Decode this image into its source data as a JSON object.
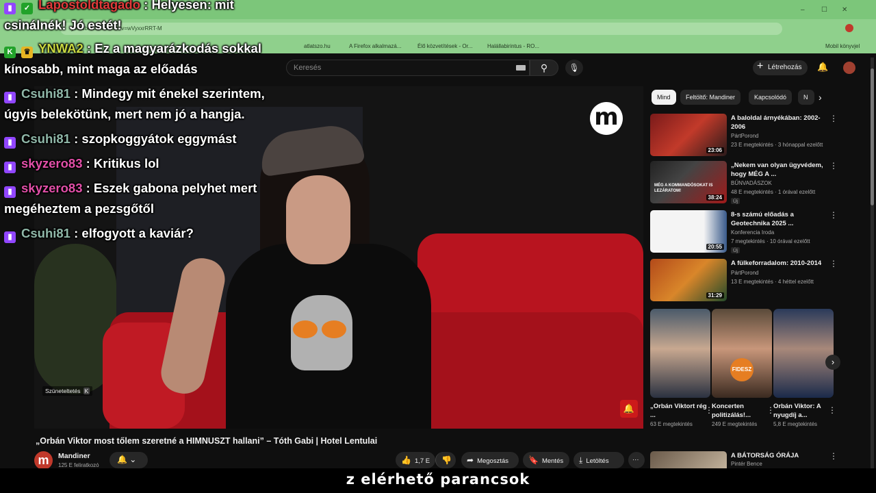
{
  "browser": {
    "url": "youtube.com/watch?v=wVyxxrRRT-M",
    "bookmarks": [
      "atlatszo.hu",
      "A Firefox alkalmazá...",
      "Élő közvetítések - Or...",
      "Halállabirintus - RO...",
      "Mobil könyvjel"
    ],
    "window_controls": [
      "–",
      "☐",
      "✕"
    ]
  },
  "youtube": {
    "search_placeholder": "Keresés",
    "create_label": "Létrehozás",
    "video": {
      "logo_letter": "m",
      "pause_tip": "Szüneteltetés",
      "pause_key": "K",
      "title": "„Orbán Viktor most tőlem szeretné a HIMNUSZT hallani” – Tóth Gabi | Hotel Lentulai",
      "channel": "Mandiner",
      "channel_letter": "m",
      "subscribers": "125 E feliratkozó",
      "like_count": "1,7 E",
      "share_label": "Megosztás",
      "save_label": "Mentés",
      "download_label": "Letöltés"
    },
    "chips": [
      "Mind",
      "Feltöltő: Mandiner",
      "Kapcsolódó",
      "N"
    ],
    "recommendations": [
      {
        "title": "A baloldal árnyékában: 2002-2006",
        "channel": "PártPorond",
        "meta": "23 E megtekintés · 3 hónappal ezelőtt",
        "duration": "23:06",
        "new": ""
      },
      {
        "title": "„Nekem van olyan ügyvédem, hogy MÉG A ...",
        "channel": "BŰNVADÁSZOK",
        "meta": "48 E megtekintés · 1 órával ezelőtt",
        "duration": "38:24",
        "new": "Új",
        "thumb_text": "MÉG A KOMMANDÓSOKAT IS LEZÁRATOM!"
      },
      {
        "title": "8-s számú előadás a Geotechnika 2025 ...",
        "channel": "Konferencia Iroda",
        "meta": "7 megtekintés · 10 órával ezelőtt",
        "duration": "20:55",
        "new": "Új"
      },
      {
        "title": "A fülkeforradalom: 2010-2014",
        "channel": "PártPorond",
        "meta": "13 E megtekintés · 4 héttel ezelőtt",
        "duration": "31:29",
        "new": ""
      }
    ],
    "shorts": [
      {
        "title": "„Orbán Viktort rég ...",
        "views": "63 E megtekintés"
      },
      {
        "title": "Koncerten politizálás!...",
        "views": "249 E megtekintés",
        "thumb_text": "FIDESZ"
      },
      {
        "title": "Orbán Viktor: A nyugdíj a...",
        "views": "5,8 E megtekintés"
      }
    ],
    "bottom_rec": {
      "title": "A BÁTORSÁG ÓRÁJA",
      "channel": "Pintér Bence"
    }
  },
  "chat": [
    {
      "badges": [
        "twitch",
        "green"
      ],
      "user": "Lapostoldtagado",
      "user_color": "#e03b3b",
      "message": " : Helyesen: mit",
      "cont": "csinálnék! Jó estét!"
    },
    {
      "badges": [
        "green",
        "crown"
      ],
      "user": "YNWA2",
      "user_color": "#c9d840",
      "message": " : Ez a magyarázkodás sokkal",
      "cont": "kínosabb, mint maga az előadás"
    },
    {
      "badges": [
        "twitch"
      ],
      "user": "Csuhi81",
      "user_color": "#8fb7a8",
      "message": " : Mindegy mit énekel szerintem,",
      "cont": "úgyis belekötünk, mert nem jó a hangja."
    },
    {
      "badges": [
        "twitch"
      ],
      "user": "Csuhi81",
      "user_color": "#8fb7a8",
      "message": " : szopkoggyátok eggymást",
      "cont": ""
    },
    {
      "badges": [
        "twitch"
      ],
      "user": "skyzero83",
      "user_color": "#e24fa8",
      "message": " : Kritikus lol",
      "cont": ""
    },
    {
      "badges": [
        "twitch"
      ],
      "user": "skyzero83",
      "user_color": "#e24fa8",
      "message": " : Eszek gabona pelyhet mert",
      "cont": "megéheztem a pezsgőtől"
    },
    {
      "badges": [
        "twitch"
      ],
      "user": "Csuhi81",
      "user_color": "#8fb7a8",
      "message": " : elfogyott a kaviár?",
      "cont": ""
    }
  ],
  "caption": "z elérhető parancsok",
  "colors": {
    "accent_red": "#cc1a1a",
    "twitch_purple": "#9146ff",
    "browser_green": "#8fd08c"
  }
}
